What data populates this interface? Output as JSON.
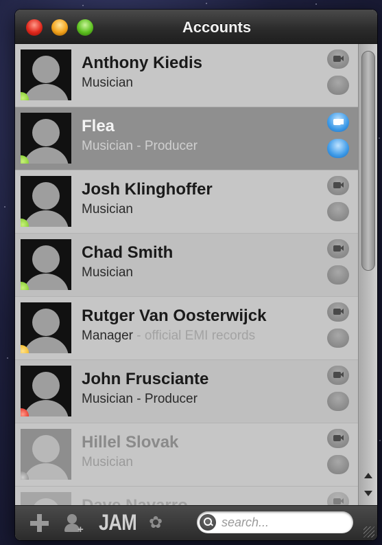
{
  "window": {
    "title": "Accounts"
  },
  "status_colors": {
    "available": "#7ecb2a",
    "away": "#f2b51c",
    "busy": "#e2271b",
    "offline": "#8a8a8a"
  },
  "contacts": [
    {
      "name": "Anthony Kiedis",
      "role": "Musician",
      "role_extra": "",
      "status": "available",
      "status_color": "#7ecb2a"
    },
    {
      "name": "Flea",
      "role": "Musician - Producer",
      "role_extra": "",
      "status": "available",
      "status_color": "#7ecb2a",
      "selected": true
    },
    {
      "name": "Josh Klinghoffer",
      "role": "Musician",
      "role_extra": "",
      "status": "available",
      "status_color": "#7ecb2a"
    },
    {
      "name": "Chad Smith",
      "role": "Musician",
      "role_extra": "",
      "status": "available",
      "status_color": "#7ecb2a"
    },
    {
      "name": "Rutger Van Oosterwijck",
      "role": "Manager",
      "role_extra": " - official EMI records",
      "status": "away",
      "status_color": "#f2b51c"
    },
    {
      "name": "John Frusciante",
      "role": "Musician - Producer",
      "role_extra": "",
      "status": "busy",
      "status_color": "#e2271b"
    },
    {
      "name": "Hillel Slovak",
      "role": "Musician",
      "role_extra": "",
      "status": "offline",
      "status_color": "#8a8a8a"
    },
    {
      "name": "Dave Navarro",
      "role": "",
      "role_extra": "",
      "status": "offline",
      "status_color": "#8a8a8a"
    }
  ],
  "toolbar": {
    "add_icon": "plus-icon",
    "add_contact_icon": "add-user-icon",
    "add_contact_plus": "+",
    "jam_label": "JAM",
    "settings_icon": "gear-icon",
    "settings_glyph": "✿",
    "search_placeholder": "search..."
  }
}
